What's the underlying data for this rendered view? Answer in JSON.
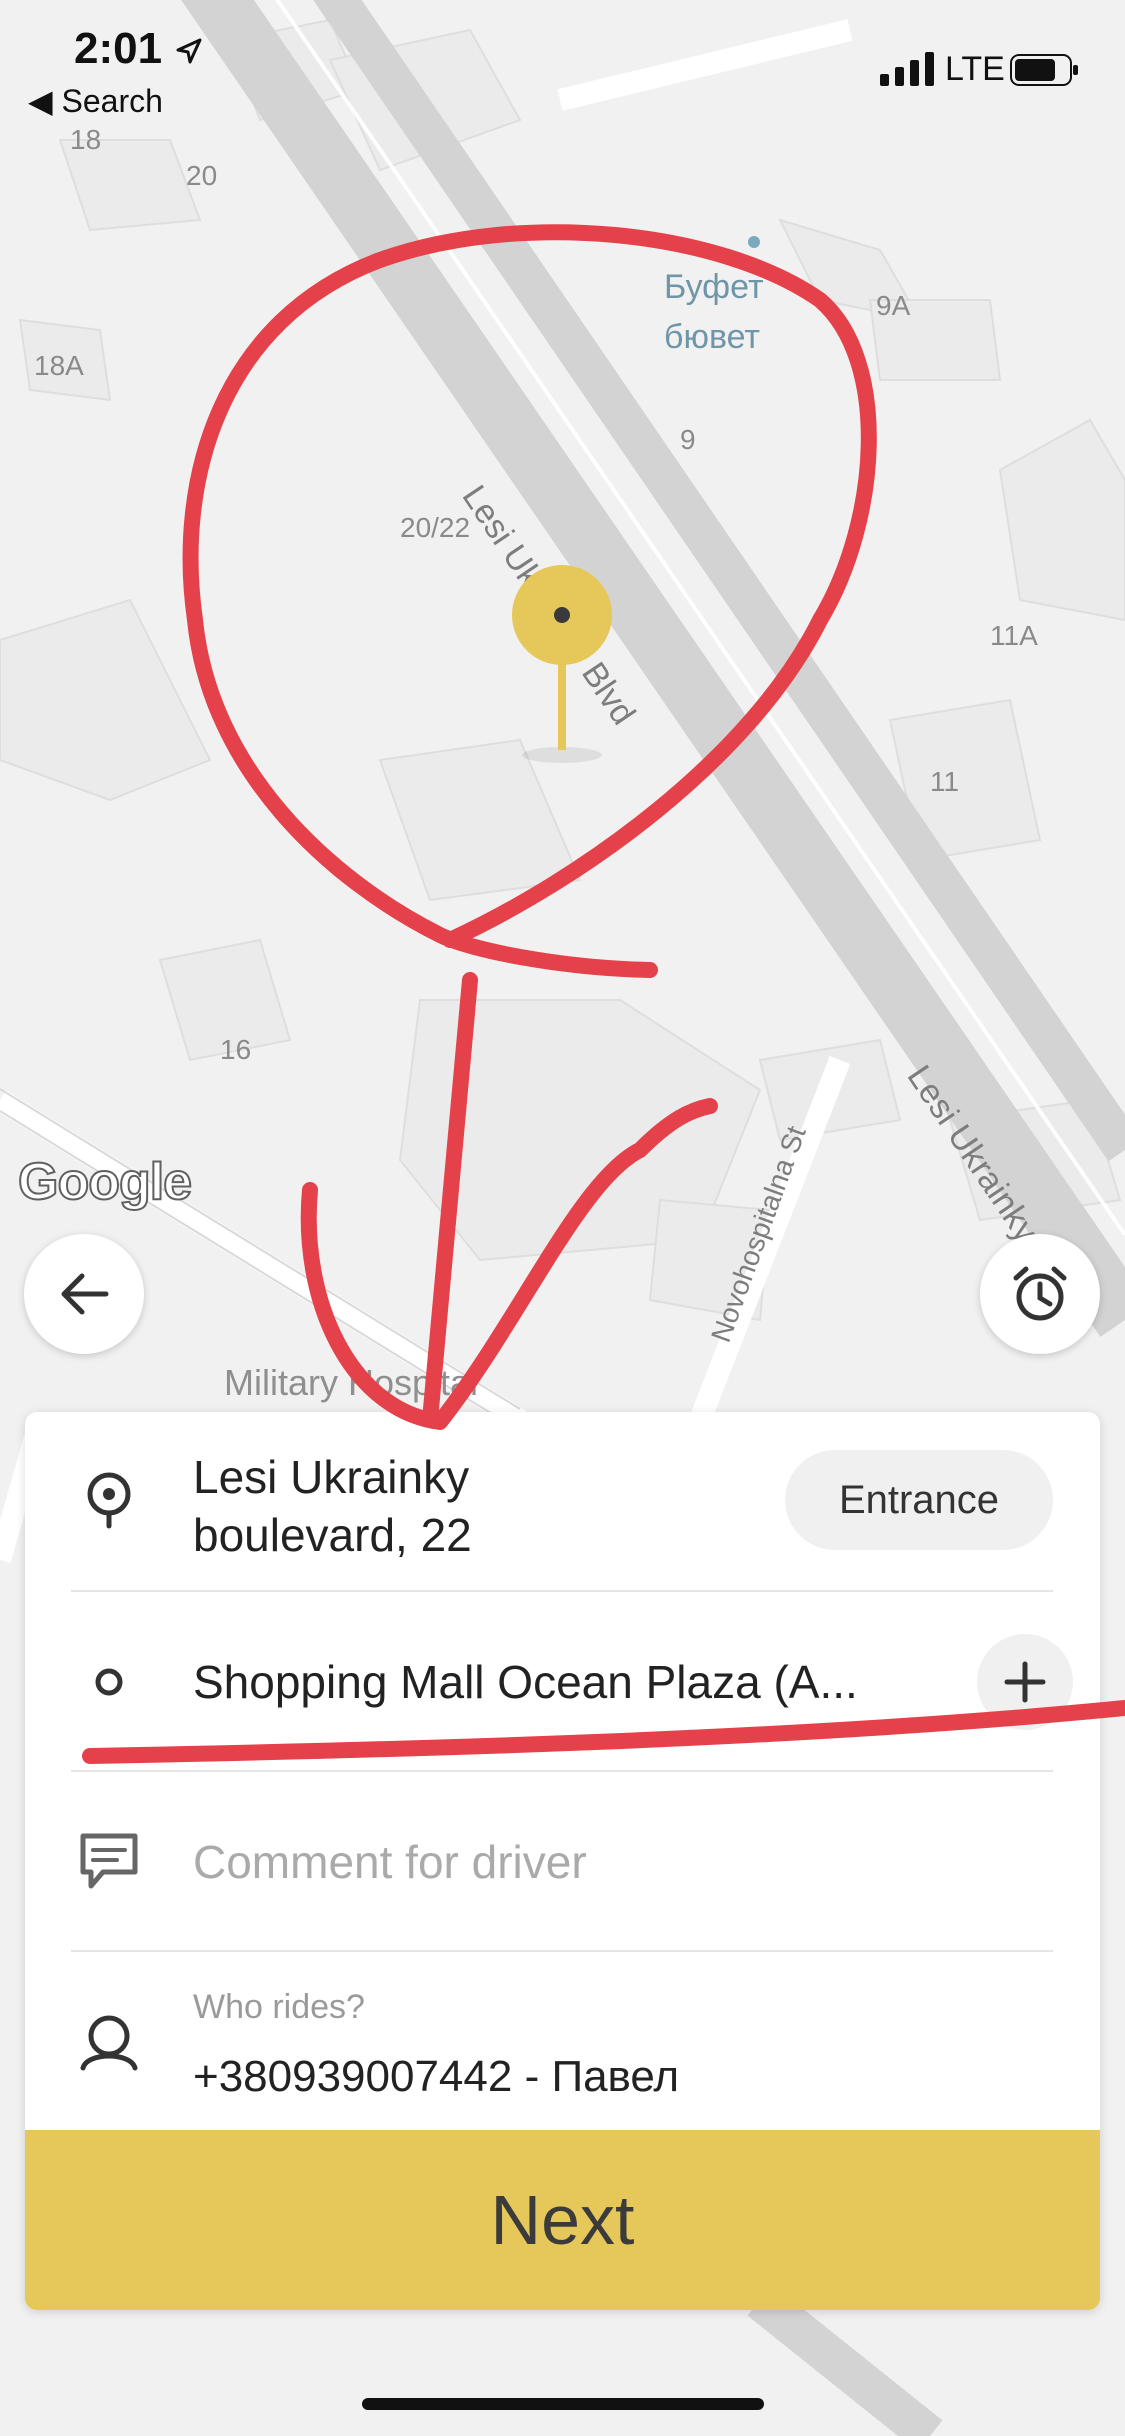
{
  "status_bar": {
    "time": "2:01",
    "back_app": "◀ Search",
    "network": "LTE"
  },
  "map": {
    "building_numbers": [
      "18",
      "20",
      "18A",
      "20/22",
      "9",
      "9A",
      "11A",
      "11",
      "16"
    ],
    "streets": [
      "Lesi Ukrainky Blvd",
      "Lesi Ukrainky Blvd",
      "Novohospitalna St"
    ],
    "poi": {
      "name_line1": "Буфет",
      "name_line2": "бювет"
    },
    "place_label": "Military Hospital",
    "attribution": "Google",
    "pin_color": "#e6c85a"
  },
  "buttons": {
    "back_icon": "arrow-left-icon",
    "schedule_icon": "alarm-clock-icon"
  },
  "ride_form": {
    "pickup": {
      "line1": "Lesi Ukrainky",
      "line2": "boulevard, 22",
      "entrance_label": "Entrance"
    },
    "destination": {
      "text": "Shopping Mall Ocean Plaza (A..."
    },
    "comment": {
      "placeholder": "Comment for driver"
    },
    "rider": {
      "label": "Who rides?",
      "value": "+380939007442 - Павел"
    },
    "next_label": "Next",
    "accent_color": "#e6c85a"
  },
  "annotation_color": "#e5414a"
}
